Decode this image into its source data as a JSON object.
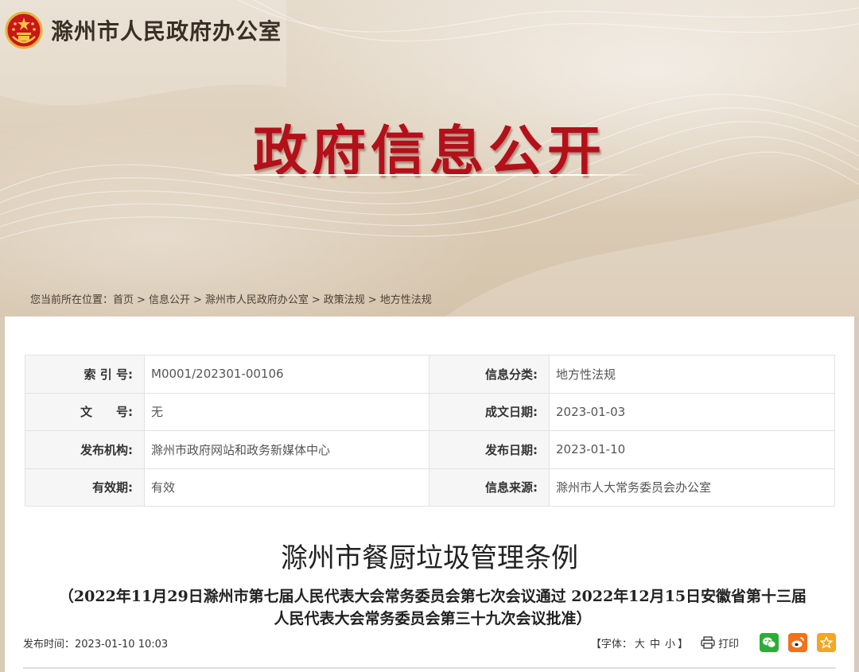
{
  "site": {
    "name": "滁州市人民政府办公室",
    "banner_title": "政府信息公开"
  },
  "breadcrumb": {
    "prefix": "您当前所在位置：",
    "items": [
      "首页",
      "信息公开",
      "滁州市人民政府办公室",
      "政策法规",
      "地方性法规"
    ],
    "separator": ">"
  },
  "meta": {
    "rows": [
      {
        "k1": "索 引 号:",
        "v1": "M0001/202301-00106",
        "k2": "信息分类:",
        "v2": "地方性法规"
      },
      {
        "k1": "文　　号:",
        "v1": "无",
        "k2": "成文日期:",
        "v2": "2023-01-03"
      },
      {
        "k1": "发布机构:",
        "v1": "滁州市政府网站和政务新媒体中心",
        "k2": "发布日期:",
        "v2": "2023-01-10"
      },
      {
        "k1": "有效期:",
        "v1": "有效",
        "k2": "信息来源:",
        "v2": "滁州市人大常务委员会办公室"
      }
    ]
  },
  "document": {
    "title": "滁州市餐厨垃圾管理条例",
    "subtitle_line1": "（2022年11月29日滁州市第七届人民代表大会常务委员会第七次会议通过 2022年12月15日安徽省第十三届",
    "subtitle_line2": "人民代表大会常务委员会第三十九次会议批准）"
  },
  "toolbar": {
    "publish_label": "发布时间：",
    "publish_time": "2023-01-10 10:03",
    "font_open": "【字体：",
    "font_large": "大",
    "font_medium": "中",
    "font_small": "小",
    "font_close": "】",
    "print_label": "打印"
  },
  "icons": {
    "emblem": "national-emblem-icon",
    "print": "printer-icon",
    "wechat": "wechat-icon",
    "weibo": "weibo-icon",
    "favorite": "star-icon"
  },
  "colors": {
    "title_red": "#b3101a",
    "wechat": "#2aae37",
    "weibo": "#f0731b",
    "favorite": "#f5a623"
  }
}
